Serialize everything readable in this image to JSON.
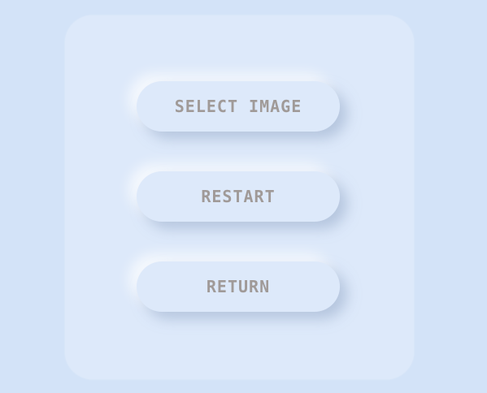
{
  "menu": {
    "buttons": [
      {
        "label": "SELECT IMAGE"
      },
      {
        "label": "RESTART"
      },
      {
        "label": "RETURN"
      }
    ]
  },
  "colors": {
    "background": "#d3e3f8",
    "panel": "#dde9fa",
    "button_text": "#a09a98"
  }
}
